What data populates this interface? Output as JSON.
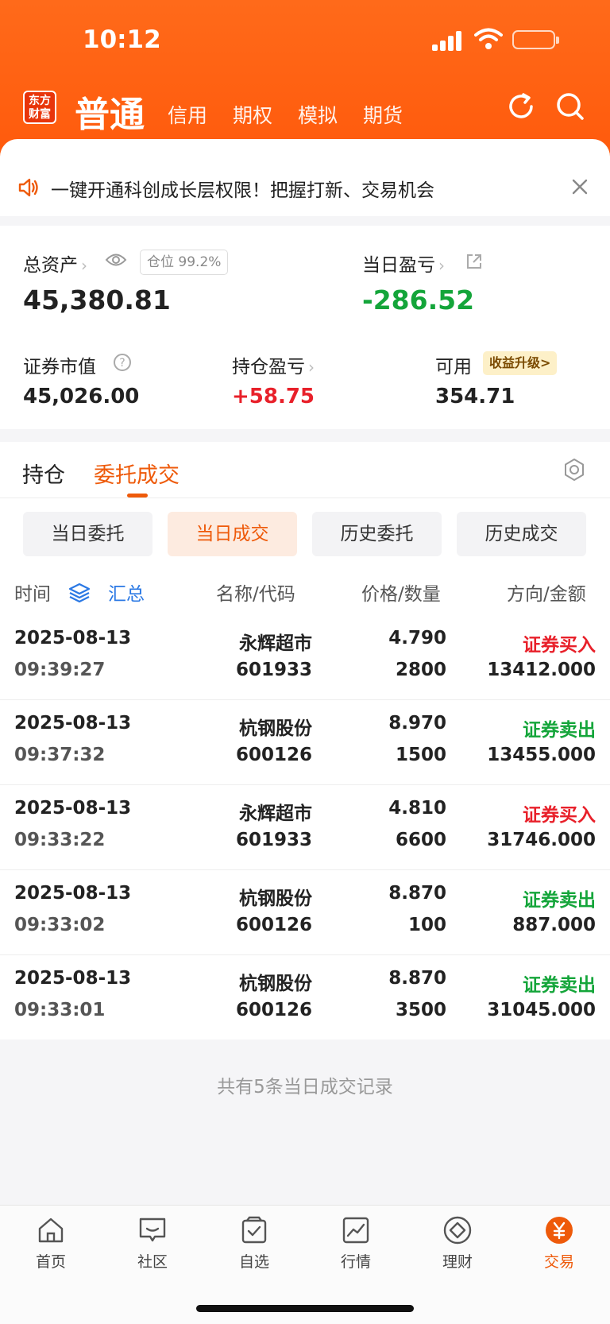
{
  "status": {
    "time": "10:12"
  },
  "header": {
    "logo_line1": "东方",
    "logo_line2": "财富",
    "active_tab": "普通",
    "tabs": [
      "信用",
      "期权",
      "模拟",
      "期货"
    ]
  },
  "notice": {
    "text": "一键开通科创成长层权限！把握打新、交易机会"
  },
  "assets": {
    "total_label": "总资产",
    "position_badge": "仓位 99.2%",
    "total_value": "45,380.81",
    "daily_pl_label": "当日盈亏",
    "daily_pl_value": "-286.52",
    "market_value_label": "证券市值",
    "market_value": "45,026.00",
    "holding_pl_label": "持仓盈亏",
    "holding_pl_value": "+58.75",
    "available_label": "可用",
    "upgrade_badge": "收益升级>",
    "available_value": "354.71"
  },
  "tabs": {
    "holdings": "持仓",
    "orders": "委托成交"
  },
  "segments": [
    "当日委托",
    "当日成交",
    "历史委托",
    "历史成交"
  ],
  "columns": {
    "time": "时间",
    "summary": "汇总",
    "name_code": "名称/代码",
    "price_qty": "价格/数量",
    "direction_amount": "方向/金额"
  },
  "trades": [
    {
      "date": "2025-08-13",
      "time": "09:39:27",
      "name": "永辉超市",
      "code": "601933",
      "price": "4.790",
      "qty": "2800",
      "direction": "证券买入",
      "amount": "13412.000"
    },
    {
      "date": "2025-08-13",
      "time": "09:37:32",
      "name": "杭钢股份",
      "code": "600126",
      "price": "8.970",
      "qty": "1500",
      "direction": "证券卖出",
      "amount": "13455.000"
    },
    {
      "date": "2025-08-13",
      "time": "09:33:22",
      "name": "永辉超市",
      "code": "601933",
      "price": "4.810",
      "qty": "6600",
      "direction": "证券买入",
      "amount": "31746.000"
    },
    {
      "date": "2025-08-13",
      "time": "09:33:02",
      "name": "杭钢股份",
      "code": "600126",
      "price": "8.870",
      "qty": "100",
      "direction": "证券卖出",
      "amount": "887.000"
    },
    {
      "date": "2025-08-13",
      "time": "09:33:01",
      "name": "杭钢股份",
      "code": "600126",
      "price": "8.870",
      "qty": "3500",
      "direction": "证券卖出",
      "amount": "31045.000"
    }
  ],
  "footer": {
    "summary_text": "共有5条当日成交记录"
  },
  "bottom_nav": [
    "首页",
    "社区",
    "自选",
    "行情",
    "理财",
    "交易"
  ],
  "colors": {
    "accent": "#ee5a0a",
    "buy": "#e8202a",
    "sell": "#14a53a",
    "header": "#ff5a0c"
  }
}
